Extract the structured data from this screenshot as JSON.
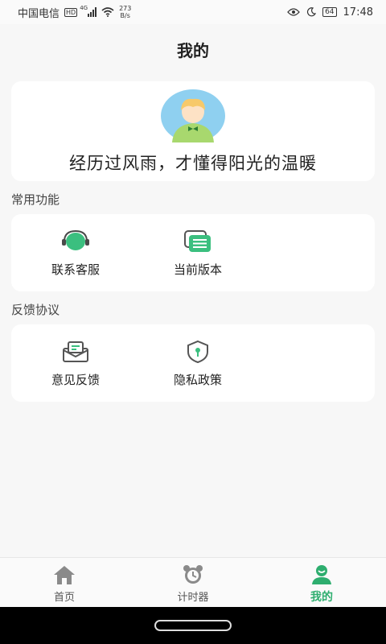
{
  "status_bar": {
    "carrier": "中国电信",
    "hd": "HD",
    "network": "4G",
    "speed_value": "273",
    "speed_unit": "B/s",
    "battery": "64",
    "time": "17:48"
  },
  "header": {
    "title": "我的"
  },
  "profile": {
    "motto": "经历过风雨，才懂得阳光的温暖"
  },
  "sections": {
    "common": {
      "title": "常用功能",
      "items": [
        {
          "label": "联系客服",
          "icon": "headset-icon"
        },
        {
          "label": "当前版本",
          "icon": "version-list-icon"
        }
      ]
    },
    "feedback": {
      "title": "反馈协议",
      "items": [
        {
          "label": "意见反馈",
          "icon": "mail-icon"
        },
        {
          "label": "隐私政策",
          "icon": "shield-lock-icon"
        }
      ]
    }
  },
  "tabbar": {
    "tabs": [
      {
        "label": "首页",
        "icon": "home-icon"
      },
      {
        "label": "计时器",
        "icon": "alarm-clock-icon"
      },
      {
        "label": "我的",
        "icon": "user-icon"
      }
    ],
    "active_index": 2
  },
  "colors": {
    "accent": "#2eae6f",
    "icon_gray": "#8a8a8a"
  }
}
